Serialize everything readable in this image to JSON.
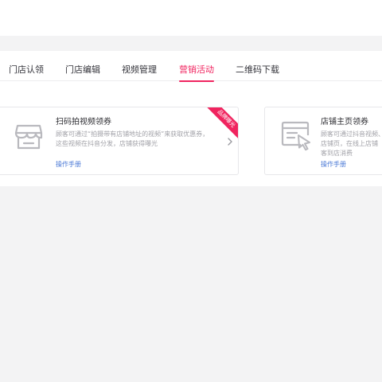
{
  "tabs": [
    {
      "label": "门店认领",
      "active": false
    },
    {
      "label": "门店编辑",
      "active": false
    },
    {
      "label": "视频管理",
      "active": false
    },
    {
      "label": "营销活动",
      "active": true
    },
    {
      "label": "二维码下载",
      "active": false
    }
  ],
  "colors": {
    "accent": "#f0245f",
    "link": "#4a78d6"
  },
  "cards": [
    {
      "icon": "store-icon",
      "title": "扫码拍视频领券",
      "desc_line1": "顾客可通过“拍摄带有店铺地址的视频”来获取优惠券，",
      "desc_line2": "这些视频在抖音分发，店铺获得曝光",
      "link": "操作手册",
      "ribbon": "品牌曝光"
    },
    {
      "icon": "browser-cursor-icon",
      "title": "店铺主页领券",
      "desc_line1": "顾客可通过抖音视频、",
      "desc_line2": "店铺页，在线上店铺",
      "desc_line3": "客到店消费",
      "link": "操作手册"
    }
  ]
}
